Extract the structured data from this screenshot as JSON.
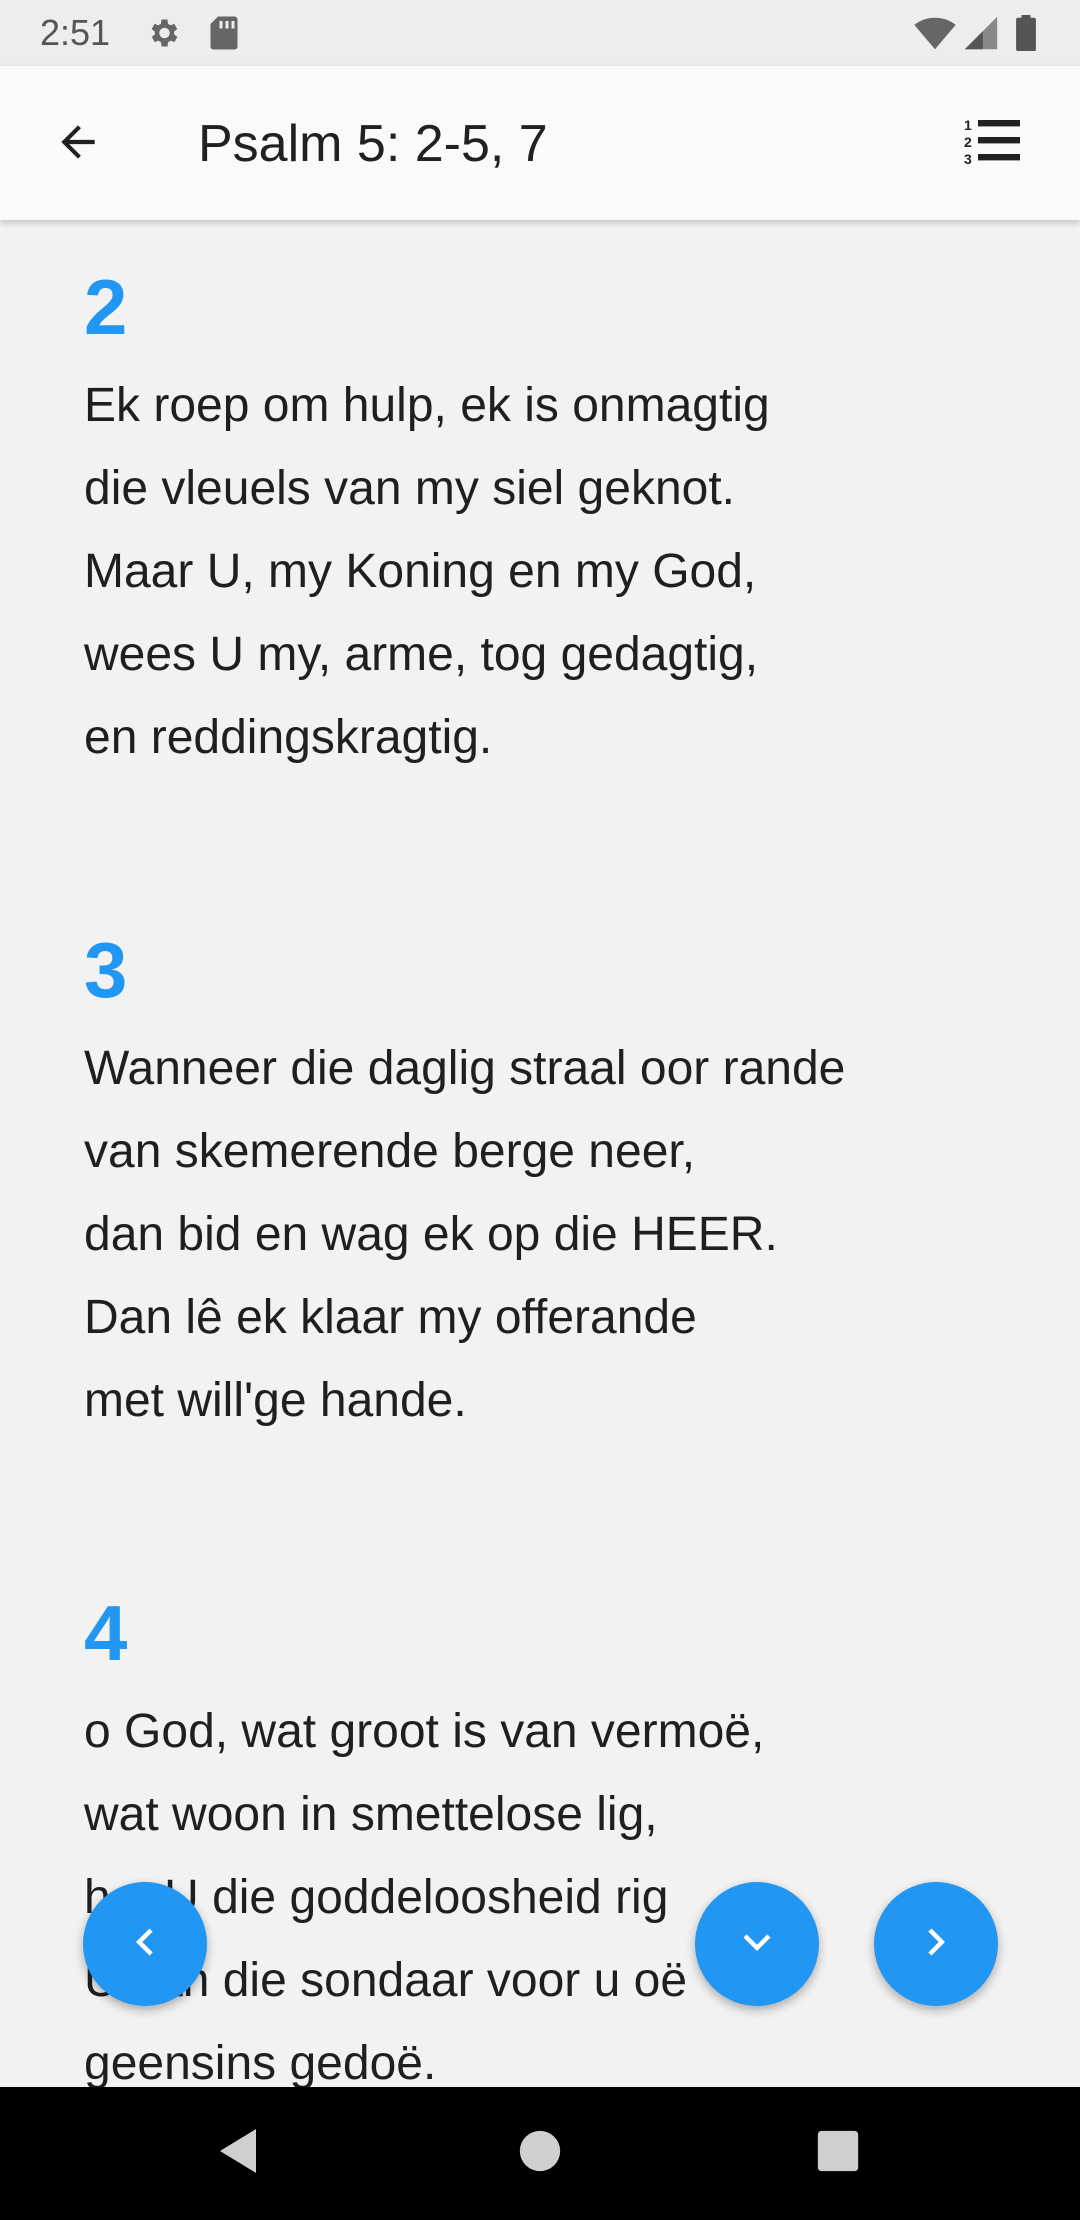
{
  "status_bar": {
    "time": "2:51",
    "icons_left": [
      "settings-icon",
      "sd-card-icon"
    ],
    "icons_right": [
      "wifi-icon",
      "signal-icon",
      "battery-icon"
    ]
  },
  "app_bar": {
    "title": "Psalm 5: 2-5, 7",
    "back_icon": "arrow-back-icon",
    "list_icon": "numbered-list-icon"
  },
  "verses": [
    {
      "number": "2",
      "lines": [
        "Ek roep om hulp, ek is onmagtig",
        "die vleuels van my siel geknot.",
        "Maar U, my Koning en my God,",
        "wees U my, arme, tog gedagtig,",
        "en reddingskragtig."
      ]
    },
    {
      "number": "3",
      "lines": [
        "Wanneer die daglig straal oor rande",
        "van skemerende berge neer,",
        "dan bid en wag ek op die HEER.",
        "Dan lê ek klaar my offerande",
        "met will'ge hande."
      ]
    },
    {
      "number": "4",
      "lines": [
        "o God, wat groot is van vermoë,",
        "wat woon in smettelose lig,",
        "het U die goddeloosheid rig",
        "U kan die sondaar voor u oë",
        "geensins gedoë."
      ]
    }
  ],
  "fabs": {
    "previous_icon": "chevron-left-icon",
    "scroll_down_icon": "chevron-down-icon",
    "next_icon": "chevron-right-icon"
  },
  "nav_bar": {
    "back_icon": "nav-back-icon",
    "home_icon": "nav-home-icon",
    "recents_icon": "nav-recents-icon"
  },
  "colors": {
    "accent": "#2196f3",
    "background": "#f2f2f2",
    "app_bar": "#fafafa",
    "text": "#1f1f1f"
  }
}
